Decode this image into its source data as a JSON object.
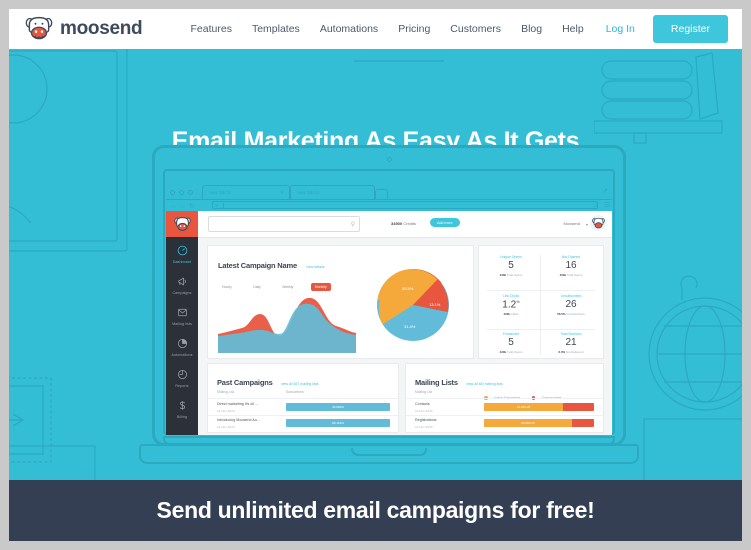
{
  "header": {
    "logo_text": "moosend",
    "logo_icon": "cow-head-logo",
    "nav": [
      {
        "label": "Features",
        "name": "features"
      },
      {
        "label": "Templates",
        "name": "templates"
      },
      {
        "label": "Automations",
        "name": "automations"
      },
      {
        "label": "Pricing",
        "name": "pricing"
      },
      {
        "label": "Customers",
        "name": "customers"
      },
      {
        "label": "Blog",
        "name": "blog"
      },
      {
        "label": "Help",
        "name": "help"
      }
    ],
    "login_label": "Log In",
    "register_label": "Register"
  },
  "hero": {
    "title": "Email Marketing As Easy As It Gets",
    "bg_color": "#34bed6"
  },
  "browser": {
    "tab1": "New Tab 01",
    "tab2": "New Tab 02",
    "close_icon": "close-icon",
    "back_icon": "back-arrow-icon",
    "forward_icon": "forward-arrow-icon",
    "reload_icon": "reload-icon",
    "url_value": "",
    "star_icon": "bookmark-star-icon",
    "menu_icon": "hamburger-menu-icon"
  },
  "app": {
    "sidebar": [
      {
        "label": "Dashboard",
        "icon": "speedometer-icon",
        "active": true
      },
      {
        "label": "Campaigns",
        "icon": "megaphone-icon",
        "active": false
      },
      {
        "label": "Mailing lists",
        "icon": "envelope-icon",
        "active": false
      },
      {
        "label": "Automations",
        "icon": "pie-slice-icon",
        "active": false
      },
      {
        "label": "Reports",
        "icon": "clock-pie-icon",
        "active": false
      },
      {
        "label": "Billing",
        "icon": "dollar-icon",
        "active": false
      }
    ],
    "topbar": {
      "search_placeholder": "",
      "search_icon": "search-icon",
      "credits_value": "34500",
      "credits_label": "Credits",
      "add_more_label": "Add more",
      "account_name": "Moosend",
      "caret_icon": "chevron-down-icon",
      "avatar_icon": "cow-avatar-icon"
    },
    "latest_campaign": {
      "title": "Latest Campaign Name",
      "link": "view details",
      "tabs": [
        "Hourly",
        "Daily",
        "Weekly",
        "Monthly"
      ],
      "active_tab": "Monthly"
    },
    "stats": [
      {
        "label": "Unique Opens",
        "value": "5",
        "suffix": "",
        "sub_value": "430k",
        "sub_label": "Total Opens"
      },
      {
        "label": "Not Opened",
        "value": "16",
        "suffix": "",
        "sub_value": "400k",
        "sub_label": "Total Opens"
      },
      {
        "label": "Link Clicks",
        "value": "1.2",
        "suffix": "%",
        "sub_value": "400k",
        "sub_label": "Clicks"
      },
      {
        "label": "Unsubscribed",
        "value": "26",
        "suffix": "",
        "sub_value": "56.5%",
        "sub_label": "Unsubscribers"
      },
      {
        "label": "Forwarded",
        "value": "5",
        "suffix": "",
        "sub_value": "430k",
        "sub_label": "Total Opens"
      },
      {
        "label": "Total Bounces",
        "value": "21",
        "suffix": "",
        "sub_value": "6.0%",
        "sub_label": "Not Delivered"
      }
    ],
    "past_campaigns": {
      "title": "Past Campaigns",
      "link": "view all 457 mailing lists",
      "col_name": "Mailing List",
      "col_value": "Subscribers",
      "rows": [
        {
          "name": "Direct marketing it's oll ...",
          "date": "21 Nov 2015",
          "bar_label": "33.692%",
          "bar_pct": 100
        },
        {
          "name": "Introducing Moosend Au...",
          "date": "21 Nov 2015",
          "bar_label": "89.192%",
          "bar_pct": 100
        }
      ]
    },
    "mailing_lists": {
      "title": "Mailing Lists",
      "link": "view all 6/0 mailing lists",
      "col_name": "Mailing List",
      "legend": [
        {
          "label": "Active Subscribers",
          "color": "#f6a93b"
        },
        {
          "label": "Unsubscribed",
          "color": "#e8563f"
        }
      ],
      "rows": [
        {
          "name": "Contacts",
          "date": "21 Nov 2015",
          "bar_label": "11.993.28",
          "active_pct": 72
        },
        {
          "name": "Registrations",
          "date": "21 Nov 2015",
          "bar_label": "80.680.20",
          "active_pct": 80
        }
      ]
    },
    "chart_data": {
      "type": "area",
      "title": "Latest Campaign Name",
      "series": [
        {
          "name": "Opens",
          "color": "#62bcd9",
          "values": [
            28,
            30,
            26,
            22,
            30,
            72,
            92,
            88,
            66,
            40,
            30,
            34,
            36
          ]
        },
        {
          "name": "Clicks",
          "color": "#e8563f",
          "values": [
            12,
            22,
            46,
            30,
            18,
            26,
            58,
            86,
            90,
            84,
            54,
            26,
            20
          ]
        }
      ],
      "ylim": [
        0,
        100
      ],
      "grid": false,
      "legend": "none"
    },
    "pie_data": {
      "type": "pie",
      "labels": [
        "55.5%",
        "31.4%",
        "13.1%"
      ],
      "values": [
        55.5,
        31.4,
        13.1
      ],
      "colors": [
        "#62bcd9",
        "#f6a93b",
        "#e8563f"
      ],
      "title": ""
    }
  },
  "footer": {
    "text": "Send unlimited email campaigns for free!",
    "bg_color": "#343f54"
  }
}
